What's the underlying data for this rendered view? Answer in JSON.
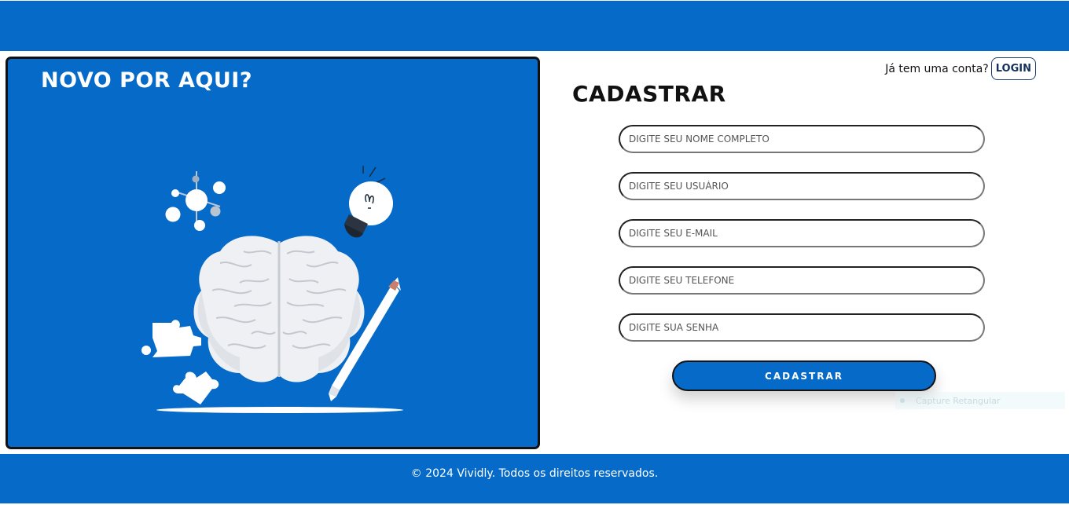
{
  "hero": {
    "title": "NOVO POR AQUI?",
    "background_color": "#066ac9"
  },
  "auth": {
    "login_prompt": "Já tem uma conta?",
    "login_button": "LOGIN"
  },
  "form": {
    "title": "CADASTRAR",
    "fields": [
      {
        "placeholder": "DIGITE SEU NOME COMPLETO",
        "value": ""
      },
      {
        "placeholder": "DIGITE SEU USUÁRIO",
        "value": ""
      },
      {
        "placeholder": "DIGITE SEU E-MAIL",
        "value": ""
      },
      {
        "placeholder": "DIGITE SEU TELEFONE",
        "value": ""
      },
      {
        "placeholder": "DIGITE SUA SENHA",
        "value": ""
      }
    ],
    "submit_label": "CADASTRAR"
  },
  "overlay": {
    "capture_label": "Capture Retangular"
  },
  "footer": {
    "text": "© 2024 Vividly. Todos os direitos reservados."
  },
  "colors": {
    "brand_blue": "#066ac9",
    "login_border": "#1a3a6a"
  },
  "icons": [
    "brain-illustration",
    "lightbulb-icon",
    "pencil-icon",
    "puzzle-piece-icon",
    "molecule-icon"
  ]
}
